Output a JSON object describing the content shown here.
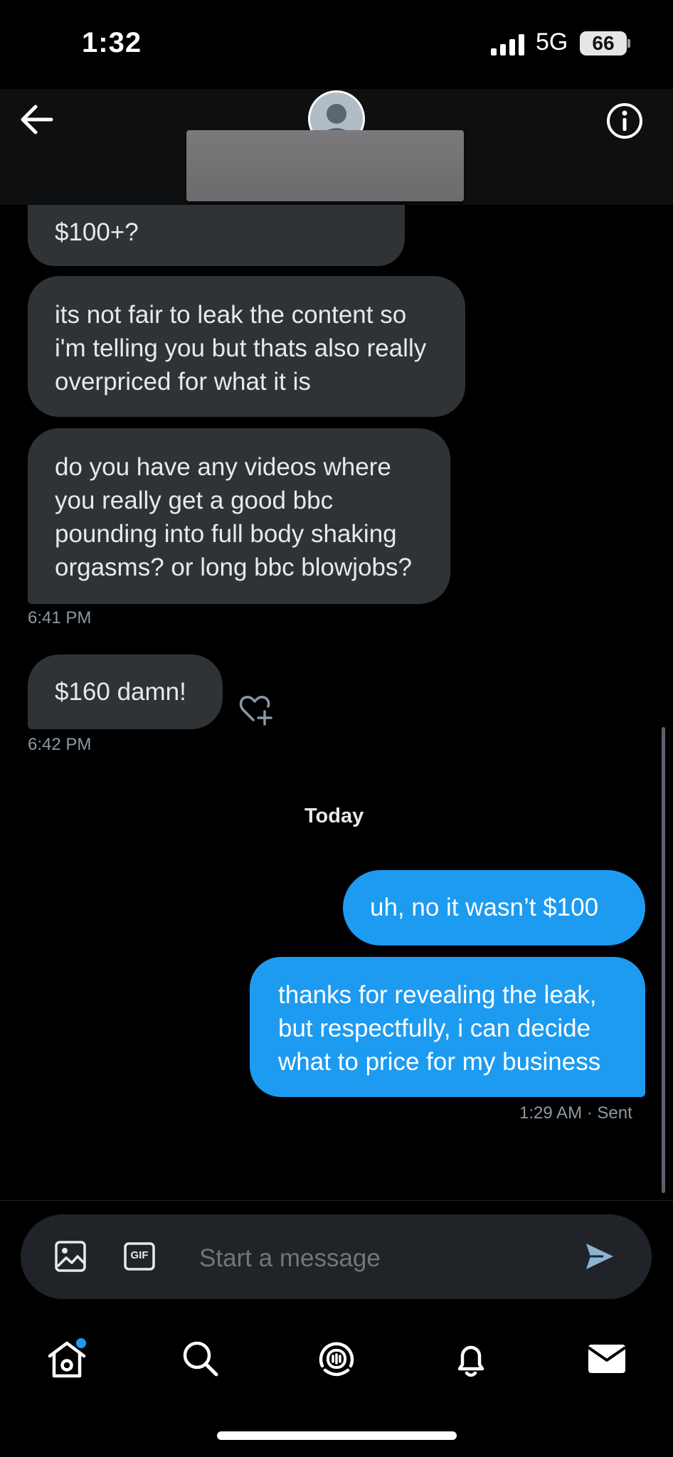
{
  "status_bar": {
    "time": "1:32",
    "network": "5G",
    "battery": "66"
  },
  "conversation_header": {
    "back_icon": "arrow-left-icon",
    "info_icon": "info-icon"
  },
  "messages": [
    {
      "direction": "received",
      "text": "$100+?"
    },
    {
      "direction": "received",
      "text": "its not fair to leak the content so i'm telling you but thats also really overpriced for what it is"
    },
    {
      "direction": "received",
      "text": "do you have any videos where you really get a good bbc pounding into full body shaking orgasms? or long bbc blowjobs?",
      "time": "6:41 PM"
    },
    {
      "direction": "received",
      "text": "$160 damn!",
      "time": "6:42 PM"
    },
    {
      "direction": "sent",
      "text": "uh, no it wasn’t $100"
    },
    {
      "direction": "sent",
      "text": "thanks for revealing the leak, but respectfully, i can decide what to price for my business",
      "time": "1:29 AM",
      "status": "· Sent"
    }
  ],
  "date_separator": "Today",
  "composer": {
    "placeholder": "Start a message",
    "gif_label": "GIF"
  },
  "tab_bar": [
    "home-icon",
    "search-icon",
    "spaces-icon",
    "notifications-icon",
    "messages-icon"
  ],
  "colors": {
    "accent": "#1d9bf0",
    "received_bubble": "#2f3336",
    "background": "#000000",
    "unread_dot": "#1d9bf0"
  }
}
